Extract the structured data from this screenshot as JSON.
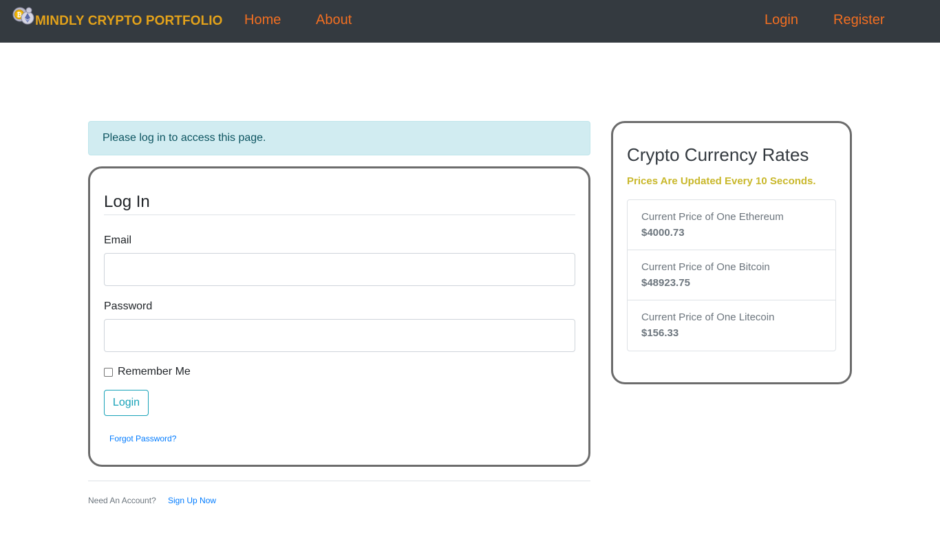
{
  "navbar": {
    "brand": "MINDLY CRYPTO PORTFOLIO",
    "logo_icon": "crypto-coins-logo",
    "links": [
      "Home",
      "About"
    ],
    "auth_links": [
      "Login",
      "Register"
    ],
    "brand_color": "#e3a21a",
    "link_color": "#f36f21",
    "background": "#343a40"
  },
  "alert": {
    "message": "Please log in to access this page."
  },
  "login_form": {
    "title": "Log In",
    "email_label": "Email",
    "email_value": "",
    "password_label": "Password",
    "password_value": "",
    "remember_label": "Remember Me",
    "remember_checked": false,
    "submit_label": "Login",
    "forgot_label": "Forgot Password?"
  },
  "footer": {
    "need_account": "Need An Account?",
    "signup_label": "Sign Up Now"
  },
  "rates": {
    "title": "Crypto Currency Rates",
    "subtitle": "Prices Are Updated Every 10 Seconds.",
    "items": [
      {
        "name": "Current Price of One Ethereum",
        "price": "$4000.73"
      },
      {
        "name": "Current Price of One Bitcoin",
        "price": "$48923.75"
      },
      {
        "name": "Current Price of One Litecoin",
        "price": "$156.33"
      }
    ]
  }
}
